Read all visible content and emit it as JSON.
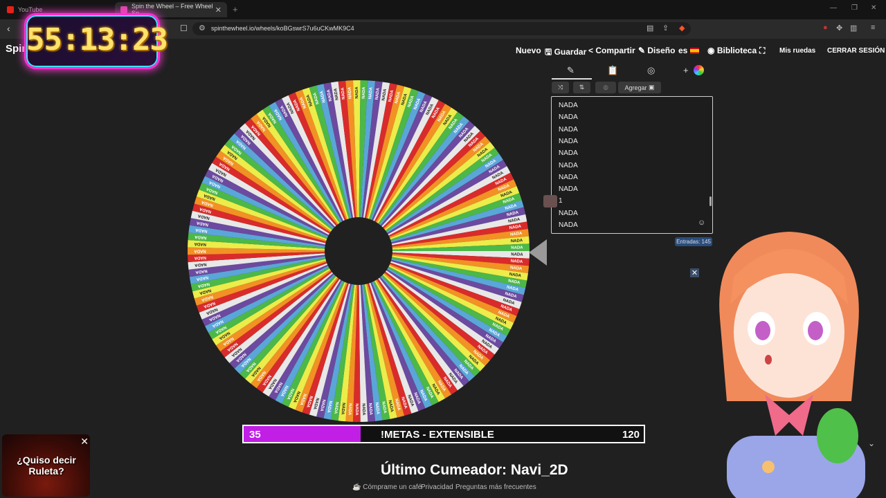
{
  "browser": {
    "tabs": [
      {
        "label": "YouTube",
        "favicon_color": "#e62117"
      },
      {
        "label": "Spin the Wheel – Free Wheel Sp",
        "favicon_color": "#d946a8"
      }
    ],
    "url": "spinthewheel.io/wheels/koBGswrS7u6uCKwMK9C4",
    "icons": [
      "back-icon",
      "forward-icon",
      "reload-icon",
      "bookmark-icon",
      "site-info-icon",
      "reader-icon",
      "share-icon",
      "brave-shield-icon",
      "extensions-icon",
      "sidebar-icon",
      "menu-icon"
    ]
  },
  "overlay": {
    "timer": "55:13:23",
    "logo_text": "Spin Whe"
  },
  "menu": {
    "nuevo": "Nuevo",
    "guardar": "Guardar",
    "compartir": "Compartir",
    "diseno": "Diseño",
    "lang": "es",
    "biblioteca": "Biblioteca",
    "mis_ruedas": "Mis ruedas",
    "cerrar": "CERRAR SESIÓN"
  },
  "panel": {
    "agregar": "Agregar",
    "entries_visible": [
      "NADA",
      "NADA",
      "NADA",
      "NADA",
      "NADA",
      "NADA",
      "NADA",
      "NADA",
      "1",
      "NADA",
      "NADA"
    ],
    "count_label": "Entradas: 145"
  },
  "wheel": {
    "segment_count": 145,
    "segment_label": "NADA",
    "colors": [
      "#e8e8e8",
      "#d92b2b",
      "#f29124",
      "#ecec4a",
      "#4cb848",
      "#5aa6d8",
      "#6c4aa0"
    ]
  },
  "goal": {
    "current": "35",
    "title": "!METAS - EXTENSIBLE",
    "target": "120",
    "progress_fraction": 0.2917,
    "fill_color": "#c11ee6"
  },
  "ultimo": "Último Cumeador: Navi_2D",
  "footer": {
    "cafe": "Cómprame un café",
    "privacidad": "Privacidad",
    "preguntas": "Preguntas más frecuentes"
  },
  "roulette_overlay": {
    "question": "¿Quiso decir Ruleta?"
  }
}
